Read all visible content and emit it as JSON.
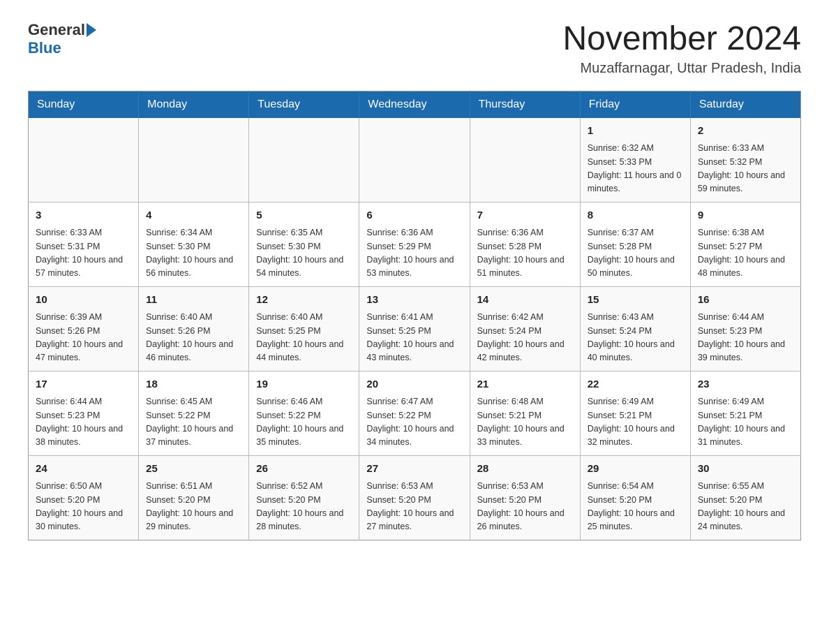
{
  "header": {
    "logo_general": "General",
    "logo_blue": "Blue",
    "month_year": "November 2024",
    "location": "Muzaffarnagar, Uttar Pradesh, India"
  },
  "weekdays": [
    "Sunday",
    "Monday",
    "Tuesday",
    "Wednesday",
    "Thursday",
    "Friday",
    "Saturday"
  ],
  "weeks": [
    [
      {
        "day": "",
        "info": ""
      },
      {
        "day": "",
        "info": ""
      },
      {
        "day": "",
        "info": ""
      },
      {
        "day": "",
        "info": ""
      },
      {
        "day": "",
        "info": ""
      },
      {
        "day": "1",
        "info": "Sunrise: 6:32 AM\nSunset: 5:33 PM\nDaylight: 11 hours and 0 minutes."
      },
      {
        "day": "2",
        "info": "Sunrise: 6:33 AM\nSunset: 5:32 PM\nDaylight: 10 hours and 59 minutes."
      }
    ],
    [
      {
        "day": "3",
        "info": "Sunrise: 6:33 AM\nSunset: 5:31 PM\nDaylight: 10 hours and 57 minutes."
      },
      {
        "day": "4",
        "info": "Sunrise: 6:34 AM\nSunset: 5:30 PM\nDaylight: 10 hours and 56 minutes."
      },
      {
        "day": "5",
        "info": "Sunrise: 6:35 AM\nSunset: 5:30 PM\nDaylight: 10 hours and 54 minutes."
      },
      {
        "day": "6",
        "info": "Sunrise: 6:36 AM\nSunset: 5:29 PM\nDaylight: 10 hours and 53 minutes."
      },
      {
        "day": "7",
        "info": "Sunrise: 6:36 AM\nSunset: 5:28 PM\nDaylight: 10 hours and 51 minutes."
      },
      {
        "day": "8",
        "info": "Sunrise: 6:37 AM\nSunset: 5:28 PM\nDaylight: 10 hours and 50 minutes."
      },
      {
        "day": "9",
        "info": "Sunrise: 6:38 AM\nSunset: 5:27 PM\nDaylight: 10 hours and 48 minutes."
      }
    ],
    [
      {
        "day": "10",
        "info": "Sunrise: 6:39 AM\nSunset: 5:26 PM\nDaylight: 10 hours and 47 minutes."
      },
      {
        "day": "11",
        "info": "Sunrise: 6:40 AM\nSunset: 5:26 PM\nDaylight: 10 hours and 46 minutes."
      },
      {
        "day": "12",
        "info": "Sunrise: 6:40 AM\nSunset: 5:25 PM\nDaylight: 10 hours and 44 minutes."
      },
      {
        "day": "13",
        "info": "Sunrise: 6:41 AM\nSunset: 5:25 PM\nDaylight: 10 hours and 43 minutes."
      },
      {
        "day": "14",
        "info": "Sunrise: 6:42 AM\nSunset: 5:24 PM\nDaylight: 10 hours and 42 minutes."
      },
      {
        "day": "15",
        "info": "Sunrise: 6:43 AM\nSunset: 5:24 PM\nDaylight: 10 hours and 40 minutes."
      },
      {
        "day": "16",
        "info": "Sunrise: 6:44 AM\nSunset: 5:23 PM\nDaylight: 10 hours and 39 minutes."
      }
    ],
    [
      {
        "day": "17",
        "info": "Sunrise: 6:44 AM\nSunset: 5:23 PM\nDaylight: 10 hours and 38 minutes."
      },
      {
        "day": "18",
        "info": "Sunrise: 6:45 AM\nSunset: 5:22 PM\nDaylight: 10 hours and 37 minutes."
      },
      {
        "day": "19",
        "info": "Sunrise: 6:46 AM\nSunset: 5:22 PM\nDaylight: 10 hours and 35 minutes."
      },
      {
        "day": "20",
        "info": "Sunrise: 6:47 AM\nSunset: 5:22 PM\nDaylight: 10 hours and 34 minutes."
      },
      {
        "day": "21",
        "info": "Sunrise: 6:48 AM\nSunset: 5:21 PM\nDaylight: 10 hours and 33 minutes."
      },
      {
        "day": "22",
        "info": "Sunrise: 6:49 AM\nSunset: 5:21 PM\nDaylight: 10 hours and 32 minutes."
      },
      {
        "day": "23",
        "info": "Sunrise: 6:49 AM\nSunset: 5:21 PM\nDaylight: 10 hours and 31 minutes."
      }
    ],
    [
      {
        "day": "24",
        "info": "Sunrise: 6:50 AM\nSunset: 5:20 PM\nDaylight: 10 hours and 30 minutes."
      },
      {
        "day": "25",
        "info": "Sunrise: 6:51 AM\nSunset: 5:20 PM\nDaylight: 10 hours and 29 minutes."
      },
      {
        "day": "26",
        "info": "Sunrise: 6:52 AM\nSunset: 5:20 PM\nDaylight: 10 hours and 28 minutes."
      },
      {
        "day": "27",
        "info": "Sunrise: 6:53 AM\nSunset: 5:20 PM\nDaylight: 10 hours and 27 minutes."
      },
      {
        "day": "28",
        "info": "Sunrise: 6:53 AM\nSunset: 5:20 PM\nDaylight: 10 hours and 26 minutes."
      },
      {
        "day": "29",
        "info": "Sunrise: 6:54 AM\nSunset: 5:20 PM\nDaylight: 10 hours and 25 minutes."
      },
      {
        "day": "30",
        "info": "Sunrise: 6:55 AM\nSunset: 5:20 PM\nDaylight: 10 hours and 24 minutes."
      }
    ]
  ]
}
